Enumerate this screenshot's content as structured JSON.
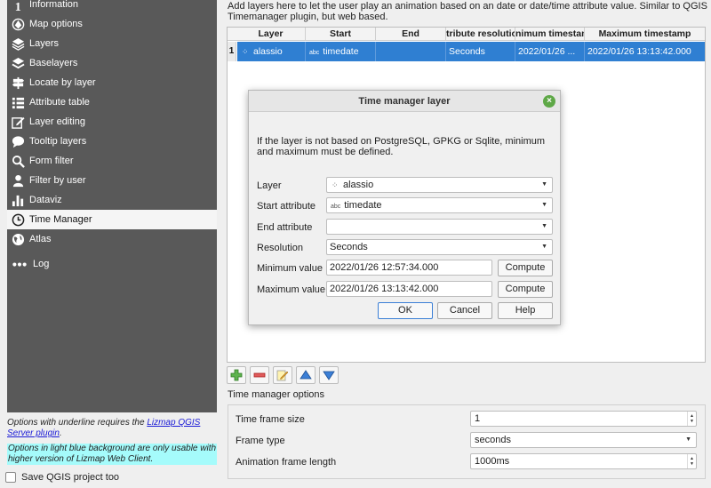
{
  "sidebar": {
    "items": [
      {
        "label": "Information",
        "icon": "info-icon"
      },
      {
        "label": "Map options",
        "icon": "map-icon"
      },
      {
        "label": "Layers",
        "icon": "layers-icon"
      },
      {
        "label": "Baselayers",
        "icon": "baselayers-icon"
      },
      {
        "label": "Locate by layer",
        "icon": "signpost-icon"
      },
      {
        "label": "Attribute table",
        "icon": "list-icon"
      },
      {
        "label": "Layer editing",
        "icon": "edit-icon"
      },
      {
        "label": "Tooltip layers",
        "icon": "speech-bubble-icon"
      },
      {
        "label": "Form filter",
        "icon": "search-icon"
      },
      {
        "label": "Filter by user",
        "icon": "user-icon"
      },
      {
        "label": "Dataviz",
        "icon": "bar-chart-icon"
      },
      {
        "label": "Time Manager",
        "icon": "clock-icon"
      },
      {
        "label": "Atlas",
        "icon": "globe-icon"
      },
      {
        "label": "Log",
        "icon": "dots-icon"
      }
    ],
    "active_index": 11
  },
  "hints": {
    "underline_prefix": "Options with underline requires the ",
    "underline_link": "Lizmap QGIS Server plugin",
    "underline_suffix": ".",
    "lightblue": "Options in light blue background are only usable with higher version of Lizmap Web Client."
  },
  "save_project_label": "Save QGIS project too",
  "main": {
    "description": "Add layers here to let the user play an animation based on an date or date/time attribute value. Similar to QGIS Timemanager plugin, but web based.",
    "table": {
      "headers": [
        "Layer",
        "Start",
        "End",
        "tribute resolutio",
        "nimum timestan",
        "Maximum timestamp"
      ],
      "row_number": "1",
      "row": {
        "layer": "alassio",
        "start": "timedate",
        "end": "",
        "resolution": "Seconds",
        "min": "2022/01/26 ...",
        "max": "2022/01/26 13:13:42.000"
      }
    },
    "options_title": "Time manager options",
    "options": {
      "frame_size_label": "Time frame size",
      "frame_size_value": "1",
      "frame_type_label": "Frame type",
      "frame_type_value": "seconds",
      "frame_length_label": "Animation frame length",
      "frame_length_value": "1000ms"
    }
  },
  "dialog": {
    "title": "Time manager layer",
    "message": "If the layer is not based on PostgreSQL, GPKG or Sqlite, minimum and maximum must be defined.",
    "layer_label": "Layer",
    "layer_value": "alassio",
    "start_label": "Start attribute",
    "start_value": "timedate",
    "end_label": "End attribute",
    "end_value": "",
    "resolution_label": "Resolution",
    "resolution_value": "Seconds",
    "min_label": "Minimum value",
    "min_value": "2022/01/26 12:57:34.000",
    "max_label": "Maximum value",
    "max_value": "2022/01/26 13:13:42.000",
    "compute_label": "Compute",
    "ok_label": "OK",
    "cancel_label": "Cancel",
    "help_label": "Help"
  },
  "colors": {
    "sidebar_bg": "#595959",
    "selection_blue": "#2f7fd2",
    "lightblue_hint": "#a5fbfb",
    "close_green": "#5ea847"
  }
}
